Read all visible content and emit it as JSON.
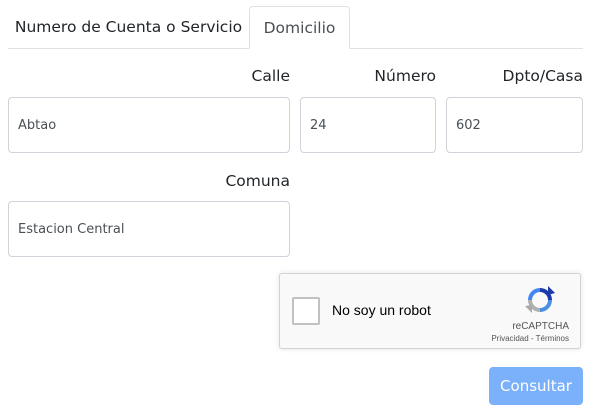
{
  "tabs": [
    {
      "label": "Numero de Cuenta o Servicio",
      "active": false
    },
    {
      "label": "Domicilio",
      "active": true
    }
  ],
  "form": {
    "calle": {
      "label": "Calle",
      "value": "Abtao"
    },
    "numero": {
      "label": "Número",
      "value": "24"
    },
    "dpto": {
      "label": "Dpto/Casa",
      "value": "602"
    },
    "comuna": {
      "label": "Comuna",
      "value": "Estacion Central"
    }
  },
  "recaptcha": {
    "checkbox_label": "No soy un robot",
    "brand": "reCAPTCHA",
    "privacy": "Privacidad",
    "separator": " - ",
    "terms": "Términos",
    "checked": false
  },
  "submit": {
    "label": "Consultar"
  },
  "colors": {
    "accent": "#7bb1fa",
    "border": "#ced4da",
    "tab_border": "#dee2e6"
  },
  "icons": {
    "recaptcha_logo": "recaptcha-icon"
  }
}
